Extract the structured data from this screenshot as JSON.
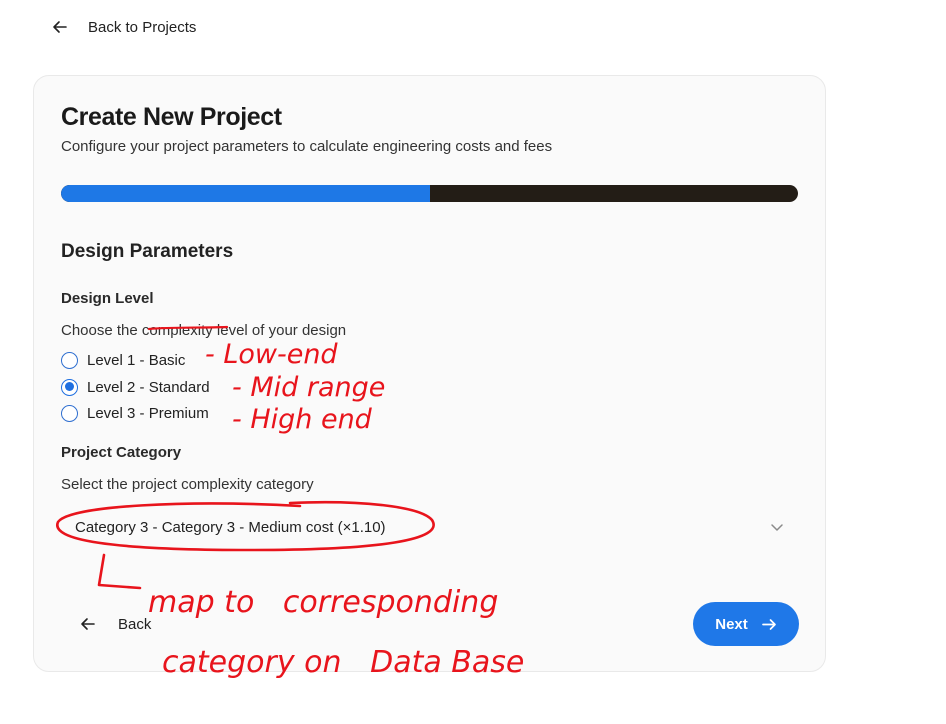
{
  "nav": {
    "back_label": "Back to Projects"
  },
  "header": {
    "title": "Create New Project",
    "subtitle": "Configure your project parameters to calculate engineering costs and fees"
  },
  "progress": {
    "fraction": 0.5
  },
  "section": {
    "title": "Design Parameters"
  },
  "design_level": {
    "label": "Design Level",
    "help": "Choose the complexity level of your design",
    "options": [
      {
        "label": "Level 1 - Basic",
        "selected": false
      },
      {
        "label": "Level 2 - Standard",
        "selected": true
      },
      {
        "label": "Level 3 - Premium",
        "selected": false
      }
    ]
  },
  "project_category": {
    "label": "Project Category",
    "help": "Select the project complexity category",
    "selected_value": "Category 3 - Category 3 - Medium cost (×1.10)"
  },
  "footer": {
    "back_label": "Back",
    "next_label": "Next"
  },
  "annotations": {
    "level_notes": [
      "- Low-end",
      "- Mid range",
      "- High end"
    ],
    "category_note_line1": "map to   corresponding",
    "category_note_line2": "category on   Data Base"
  },
  "colors": {
    "accent": "#1f78e8",
    "progress_track": "#231d16",
    "annotation_ink": "#e8141c"
  }
}
